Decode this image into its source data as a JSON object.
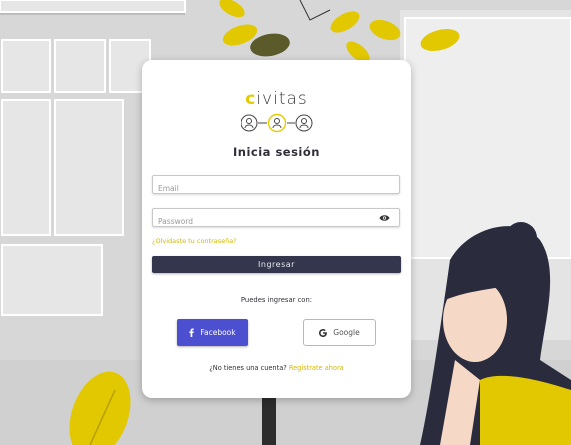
{
  "logo": {
    "first_letter": "c",
    "rest": "ivitas"
  },
  "login": {
    "title": "Inicia sesión",
    "email_placeholder": "Email",
    "password_placeholder": "Password",
    "forgot_link": "¿Olvidaste tu contraseña?",
    "submit_label": "Ingresar"
  },
  "social": {
    "prompt": "Puedes ingresar con:",
    "facebook_label": "Facebook",
    "google_label": "Google"
  },
  "signup": {
    "question": "¿No tienes una cuenta?",
    "link": "Regístrate ahora"
  },
  "colors": {
    "accent": "#e4cc00",
    "primary_button": "#33364d",
    "facebook": "#4c4fd0"
  },
  "icons": [
    "eye-icon",
    "facebook-icon",
    "google-icon",
    "user-icon"
  ]
}
